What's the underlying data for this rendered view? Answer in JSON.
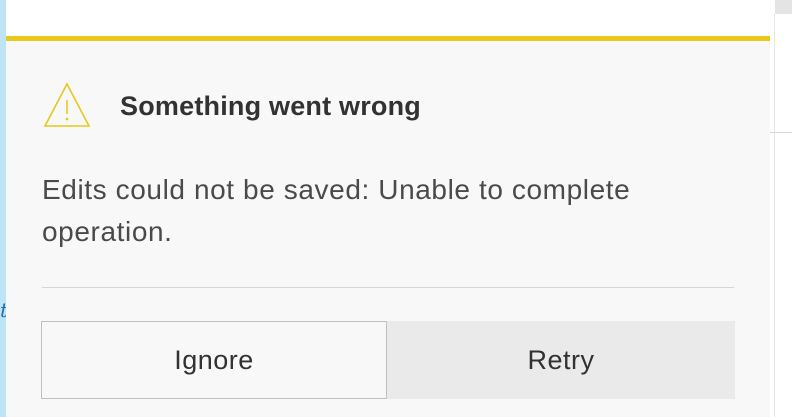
{
  "dialog": {
    "title": "Something went wrong",
    "message": "Edits could not be saved: Unable to complete operation.",
    "icon": "warning-icon",
    "accent_color": "#e8c81c",
    "buttons": {
      "ignore_label": "Ignore",
      "retry_label": "Retry"
    }
  },
  "background": {
    "left_glyph": "t"
  }
}
